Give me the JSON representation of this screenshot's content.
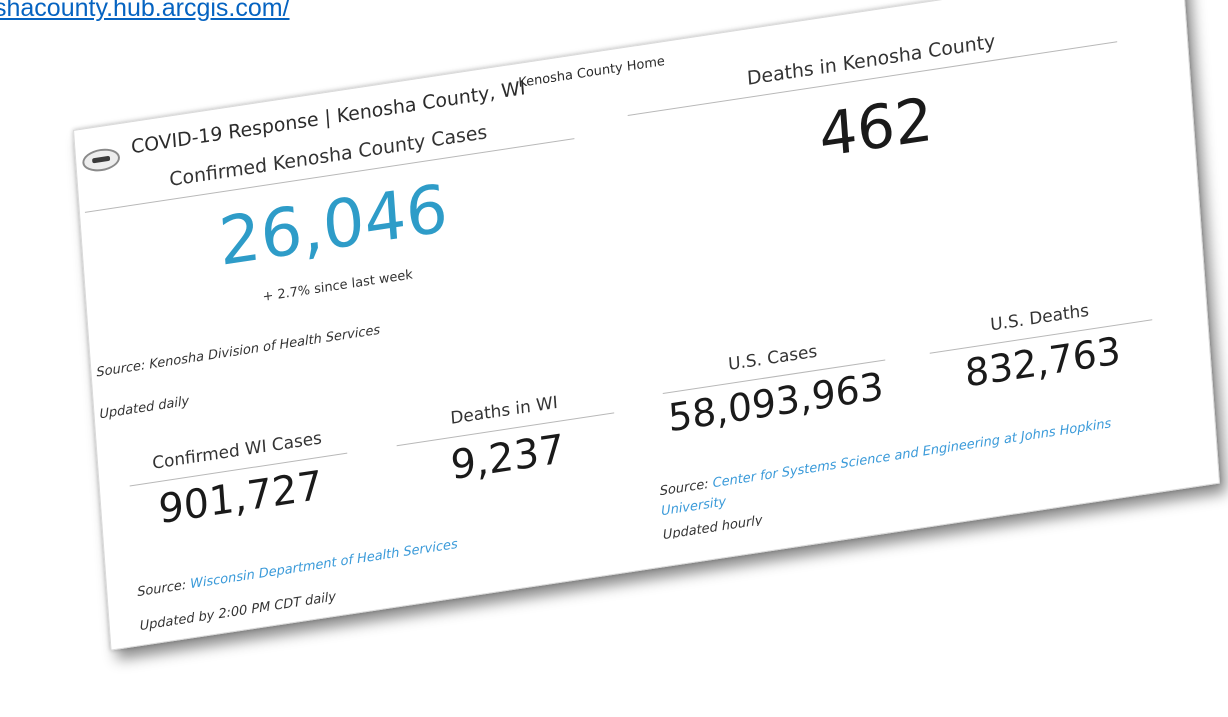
{
  "browser": {
    "url_fragment": "shacounty.hub.arcgis.com/"
  },
  "header": {
    "site_title": "COVID-19 Response | Kenosha County, WI",
    "home_link": "Kenosha County Home",
    "social_icons": [
      "twitter-icon",
      "facebook-icon"
    ]
  },
  "kenosha_cases": {
    "label": "Confirmed Kenosha County Cases",
    "value": "26,046",
    "change": "+ 2.7% since last week",
    "source": "Source: Kenosha Division of Health Services",
    "updated": "Updated daily",
    "value_color": "#2e9cc8"
  },
  "kenosha_deaths": {
    "label": "Deaths in Kenosha County",
    "value": "462"
  },
  "wi_cases": {
    "label": "Confirmed WI Cases",
    "value": "901,727"
  },
  "wi_deaths": {
    "label": "Deaths in WI",
    "value": "9,237"
  },
  "wi_source": {
    "prefix": "Source:",
    "link": "Wisconsin Department of Health Services",
    "updated": "Updated by 2:00 PM CDT daily"
  },
  "us_cases": {
    "label": "U.S. Cases",
    "value": "58,093,963"
  },
  "us_deaths": {
    "label": "U.S. Deaths",
    "value": "832,763"
  },
  "us_source": {
    "prefix": "Source:",
    "link_line1": "Center for Systems Science and Engineering at Johns Hopkins",
    "link_line2": "University",
    "updated": "Updated hourly"
  },
  "colors": {
    "accent_blue": "#2e9cc8",
    "link_blue": "#3a9ad9"
  }
}
